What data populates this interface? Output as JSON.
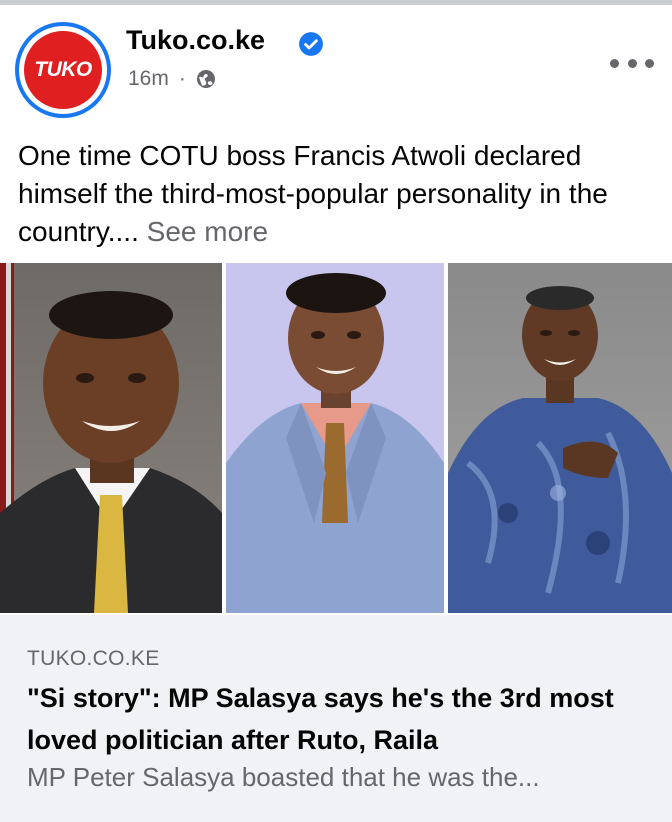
{
  "post": {
    "page_name": "Tuko.co.ke",
    "avatar_logo_text": "TUKO",
    "time": "16m",
    "separator": "·",
    "audience_icon": "globe-icon",
    "verified_icon": "verified-badge-icon",
    "more_icon": "more-options-icon",
    "text": "One time COTU boss Francis Atwoli declared himself the third-most-popular personality in the country.... ",
    "see_more": "See more"
  },
  "link_card": {
    "domain": "TUKO.CO.KE",
    "title": "\"Si story\": MP Salasya says he's the 3rd most loved politician after Ruto, Raila",
    "description": "MP Peter Salasya boasted that he was the..."
  },
  "colors": {
    "brand_red": "#e02020",
    "facebook_blue": "#1877f2",
    "secondary_text": "#65676b",
    "card_background": "#f0f2f5"
  }
}
